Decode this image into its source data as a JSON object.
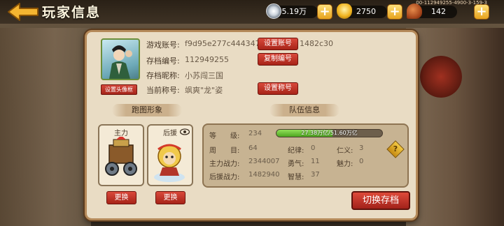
{
  "header": {
    "title": "玩家信息",
    "code": "00-112949255-4900-3-159-3"
  },
  "resources": [
    {
      "icon": "silver-coin-icon",
      "value": "145.19万"
    },
    {
      "icon": "gold-ingot-icon",
      "value": "2750"
    },
    {
      "icon": "drumstick-icon",
      "value": "142"
    }
  ],
  "profile": {
    "account_label": "游戏账号:",
    "account_value": "f9d95e277c444347",
    "account_tail": "1482c30",
    "save_id_label": "存档编号:",
    "save_id_value": "112949255",
    "nickname_label": "存档昵称:",
    "nickname_value": "小苏闯三国",
    "title_label": "当前称号:",
    "title_value": "飒爽\"龙\"姿",
    "set_account_btn": "设置账号",
    "copy_id_btn": "复制编号",
    "set_title_btn": "设置称号",
    "set_avatar_frame_btn": "设置头像框"
  },
  "sections": {
    "figure": "跑图形象",
    "team": "队伍信息"
  },
  "cards": {
    "main": "主力",
    "support": "后援",
    "swap_btn": "更换"
  },
  "stats": {
    "level_label": "等　　级:",
    "level_value": "234",
    "exp_text": "27.38万亿/51.60万亿",
    "exp_ratio": 0.53,
    "week_label": "周　　目:",
    "week_value": "64",
    "discipline_label": "纪律:",
    "discipline_value": "0",
    "benevolence_label": "仁义:",
    "benevolence_value": "3",
    "main_power_label": "主力战力:",
    "main_power_value": "2344007",
    "courage_label": "勇气:",
    "courage_value": "11",
    "charm_label": "魅力:",
    "charm_value": "0",
    "support_power_label": "后援战力:",
    "support_power_value": "1482940",
    "wisdom_label": "智慧:",
    "wisdom_value": "37"
  },
  "switch_save_btn": "切换存档",
  "colors": {
    "accent_red": "#a72418",
    "panel_bg": "#e9dcc4",
    "exp_green": "#4da61f",
    "plus_gold": "#e6a21e"
  }
}
